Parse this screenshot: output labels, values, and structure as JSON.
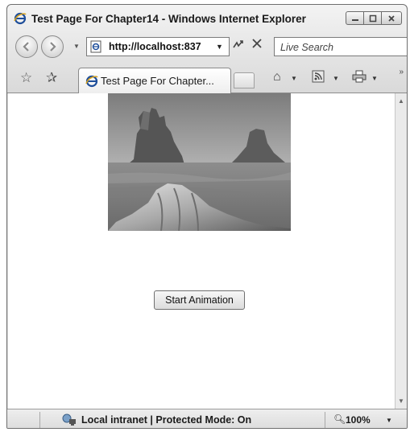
{
  "window": {
    "title": "Test Page For Chapter14 - Windows Internet Explorer"
  },
  "navigation": {
    "address": "http://localhost:837",
    "search_placeholder": "Live Search"
  },
  "tabs": [
    {
      "label": "Test Page For Chapter..."
    }
  ],
  "page": {
    "button_label": "Start Animation"
  },
  "status": {
    "zone": "Local intranet | Protected Mode: On",
    "zoom": "100%"
  },
  "icons": {
    "app": "ie-icon",
    "back": "back-icon",
    "forward": "forward-icon",
    "refresh": "refresh-icon",
    "stop": "stop-icon",
    "favorites": "favorites-star-icon",
    "add_favorites": "add-favorites-icon",
    "home": "home-icon",
    "feeds": "feeds-icon",
    "print": "print-icon"
  }
}
